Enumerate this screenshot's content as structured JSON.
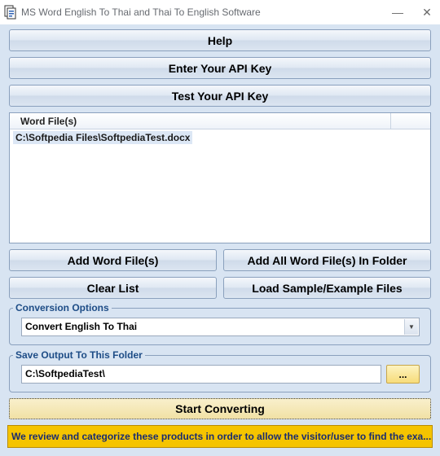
{
  "window": {
    "title": "MS Word English To Thai and Thai To English Software",
    "minimize_glyph": "—",
    "close_glyph": "✕"
  },
  "buttons": {
    "help": "Help",
    "enter_api_key": "Enter Your API Key",
    "test_api_key": "Test Your API Key",
    "add_word_files": "Add Word File(s)",
    "add_all_in_folder": "Add All Word File(s) In Folder",
    "clear_list": "Clear List",
    "load_sample": "Load Sample/Example Files",
    "browse": "...",
    "start_converting": "Start Converting"
  },
  "file_list": {
    "column_header": "Word File(s)",
    "rows": [
      "C:\\Softpedia Files\\SoftpediaTest.docx"
    ]
  },
  "conversion_options": {
    "label": "Conversion Options",
    "selected": "Convert English To Thai"
  },
  "output_folder": {
    "label": "Save Output To This Folder",
    "value": "C:\\SoftpediaTest\\"
  },
  "banner": {
    "text": "We review and categorize these products in order to allow the visitor/user to find the exa..."
  },
  "icons": {
    "app": "word-document-icon",
    "minimize": "minimize-icon",
    "close": "close-icon",
    "dropdown": "chevron-down-icon"
  },
  "colors": {
    "background": "#d8e4f2",
    "group_label": "#1d4c86",
    "banner_bg": "#f5c400",
    "banner_text": "#1a2c70"
  }
}
